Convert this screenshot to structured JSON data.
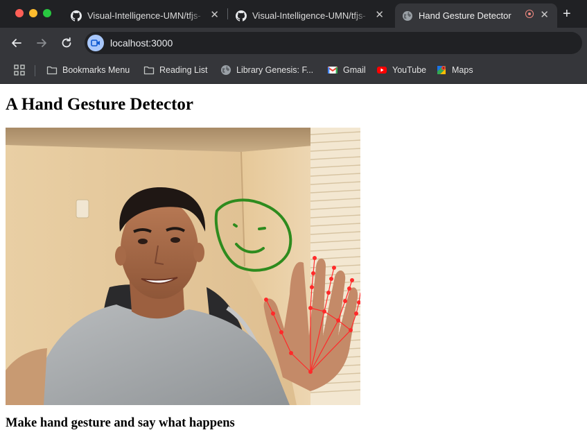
{
  "browser": {
    "tabs": [
      {
        "title": "Visual-Intelligence-UMN/tfjs-",
        "icon": "github-icon",
        "active": false
      },
      {
        "title": "Visual-Intelligence-UMN/tfjs-",
        "icon": "github-icon",
        "active": false
      },
      {
        "title": "Hand Gesture Detector",
        "icon": "globe-icon",
        "active": true
      }
    ],
    "close_glyph": "✕",
    "new_tab_glyph": "+",
    "url": "localhost:3000",
    "bookmarks": [
      {
        "label": "Bookmarks Menu",
        "icon": "folder-icon"
      },
      {
        "label": "Reading List",
        "icon": "folder-icon"
      },
      {
        "label": "Library Genesis: F...",
        "icon": "globe-icon"
      },
      {
        "label": "Gmail",
        "icon": "gmail-icon"
      },
      {
        "label": "YouTube",
        "icon": "youtube-icon"
      },
      {
        "label": "Maps",
        "icon": "maps-icon"
      }
    ],
    "colors": {
      "tab_strip": "#202124",
      "toolbar": "#35363a",
      "site_badge": "#a8c7fa",
      "recording_indicator": "#f28b82"
    }
  },
  "page": {
    "heading": "A Hand Gesture Detector",
    "video_feed": {
      "description_icon": "webcam-feed",
      "overlay": "hand-landmarks",
      "overlay_color": "#ff2a2a"
    },
    "caption": "Make hand gesture and say what happens"
  }
}
